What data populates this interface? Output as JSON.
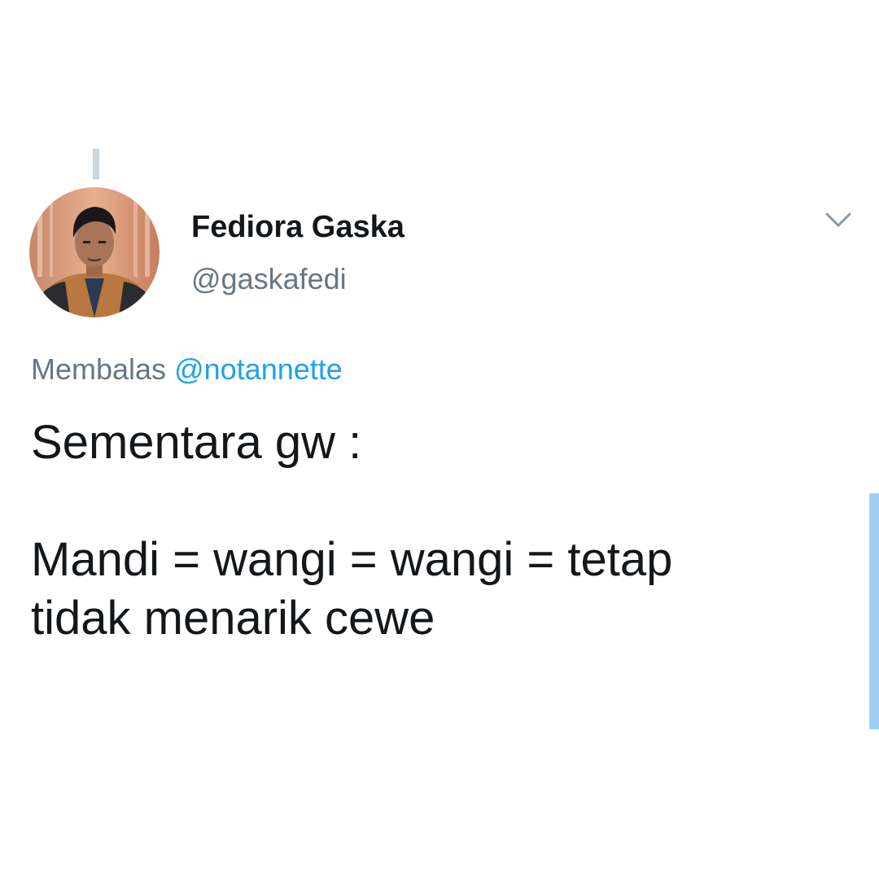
{
  "tweet": {
    "display_name": "Fediora Gaska",
    "handle": "@gaskafedi",
    "reply_prefix": "Membalas",
    "reply_mention": "@notannette",
    "text": "Sementara gw :\n\nMandi = wangi = wangi = tetap\ntidak menarik cewe"
  },
  "icons": {
    "menu": "chevron-down-icon",
    "avatar": "user-avatar-photo"
  },
  "colors": {
    "name": "#14171a",
    "secondary": "#657786",
    "link": "#1da1f2",
    "thread_line": "#ccd6dd",
    "scrollbar": "#9fcff0"
  }
}
